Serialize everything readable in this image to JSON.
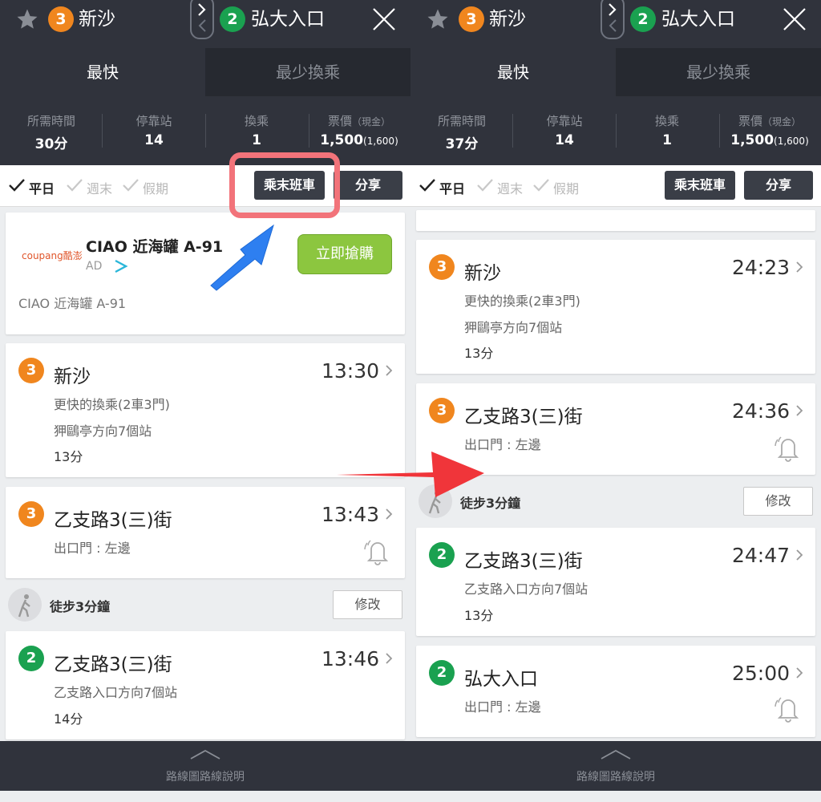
{
  "colors": {
    "header_bg": "#30333c",
    "line3": "#f0861e",
    "line2": "#1aa150",
    "cta_green": "#8cc63f",
    "highlight": "#f2737a",
    "arrow_blue": "#2e7ff0",
    "arrow_red": "#f0353a"
  },
  "icons": [
    "star-icon",
    "swap-icon",
    "close-icon",
    "check-icon",
    "chevron-right-icon",
    "bell-icon",
    "walk-icon",
    "play-icon",
    "chevron-up-icon"
  ],
  "left": {
    "header": {
      "from_line": "3",
      "from_station": "新沙",
      "to_line": "2",
      "to_station": "弘大入口"
    },
    "tabs": {
      "active": "最快",
      "inactive": "最少換乘"
    },
    "stats": {
      "time_label": "所需時間",
      "time_value": "30分",
      "stops_label": "停靠站",
      "stops_value": "14",
      "transfer_label": "換乘",
      "transfer_value": "1",
      "fare_label": "票價",
      "fare_label_note": "（現金）",
      "fare_value": "1,500",
      "fare_value_note": "(1,600)"
    },
    "filter": {
      "weekday": "平日",
      "weekend": "週末",
      "holiday": "假期",
      "last_train": "乘末班車",
      "share": "分享"
    },
    "ad": {
      "brand": "coupang酷澎",
      "title": "CIAO 近海罐 A-91",
      "ad_label": "AD",
      "cta": "立即搶購",
      "subtitle": "CIAO 近海罐 A-91"
    },
    "cards": [
      {
        "line": "3",
        "station": "新沙",
        "time": "13:30",
        "line1": "更快的換乘(2車3門)",
        "line2": "狎鷗亭方向7個站",
        "line3": "13分"
      },
      {
        "line": "3",
        "station": "乙支路3(三)街",
        "time": "13:43",
        "line1": "出口門 : 左邊"
      },
      {
        "line": "2",
        "station": "乙支路3(三)街",
        "time": "13:46",
        "line1": "乙支路入口方向7個站",
        "line2": "14分"
      }
    ],
    "walk": {
      "text": "徒步3分鐘",
      "edit": "修改"
    },
    "bottom": {
      "label": "路線圖路線說明"
    }
  },
  "right": {
    "header": {
      "from_line": "3",
      "from_station": "新沙",
      "to_line": "2",
      "to_station": "弘大入口"
    },
    "tabs": {
      "active": "最快",
      "inactive": "最少換乘"
    },
    "stats": {
      "time_label": "所需時間",
      "time_value": "37分",
      "stops_label": "停靠站",
      "stops_value": "14",
      "transfer_label": "換乘",
      "transfer_value": "1",
      "fare_label": "票價",
      "fare_label_note": "（現金）",
      "fare_value": "1,500",
      "fare_value_note": "(1,600)"
    },
    "filter": {
      "weekday": "平日",
      "weekend": "週末",
      "holiday": "假期",
      "last_train": "乘末班車",
      "share": "分享"
    },
    "cards": [
      {
        "line": "3",
        "station": "新沙",
        "time": "24:23",
        "line1": "更快的換乘(2車3門)",
        "line2": "狎鷗亭方向7個站",
        "line3": "13分"
      },
      {
        "line": "3",
        "station": "乙支路3(三)街",
        "time": "24:36",
        "line1": "出口門 : 左邊"
      },
      {
        "line": "2",
        "station": "乙支路3(三)街",
        "time": "24:47",
        "line1": "乙支路入口方向7個站",
        "line2": "13分"
      },
      {
        "line": "2",
        "station": "弘大入口",
        "time": "25:00",
        "line1": "出口門 : 左邊"
      }
    ],
    "walk": {
      "text": "徒步3分鐘",
      "edit": "修改"
    },
    "bottom": {
      "label": "路線圖路線說明"
    }
  }
}
